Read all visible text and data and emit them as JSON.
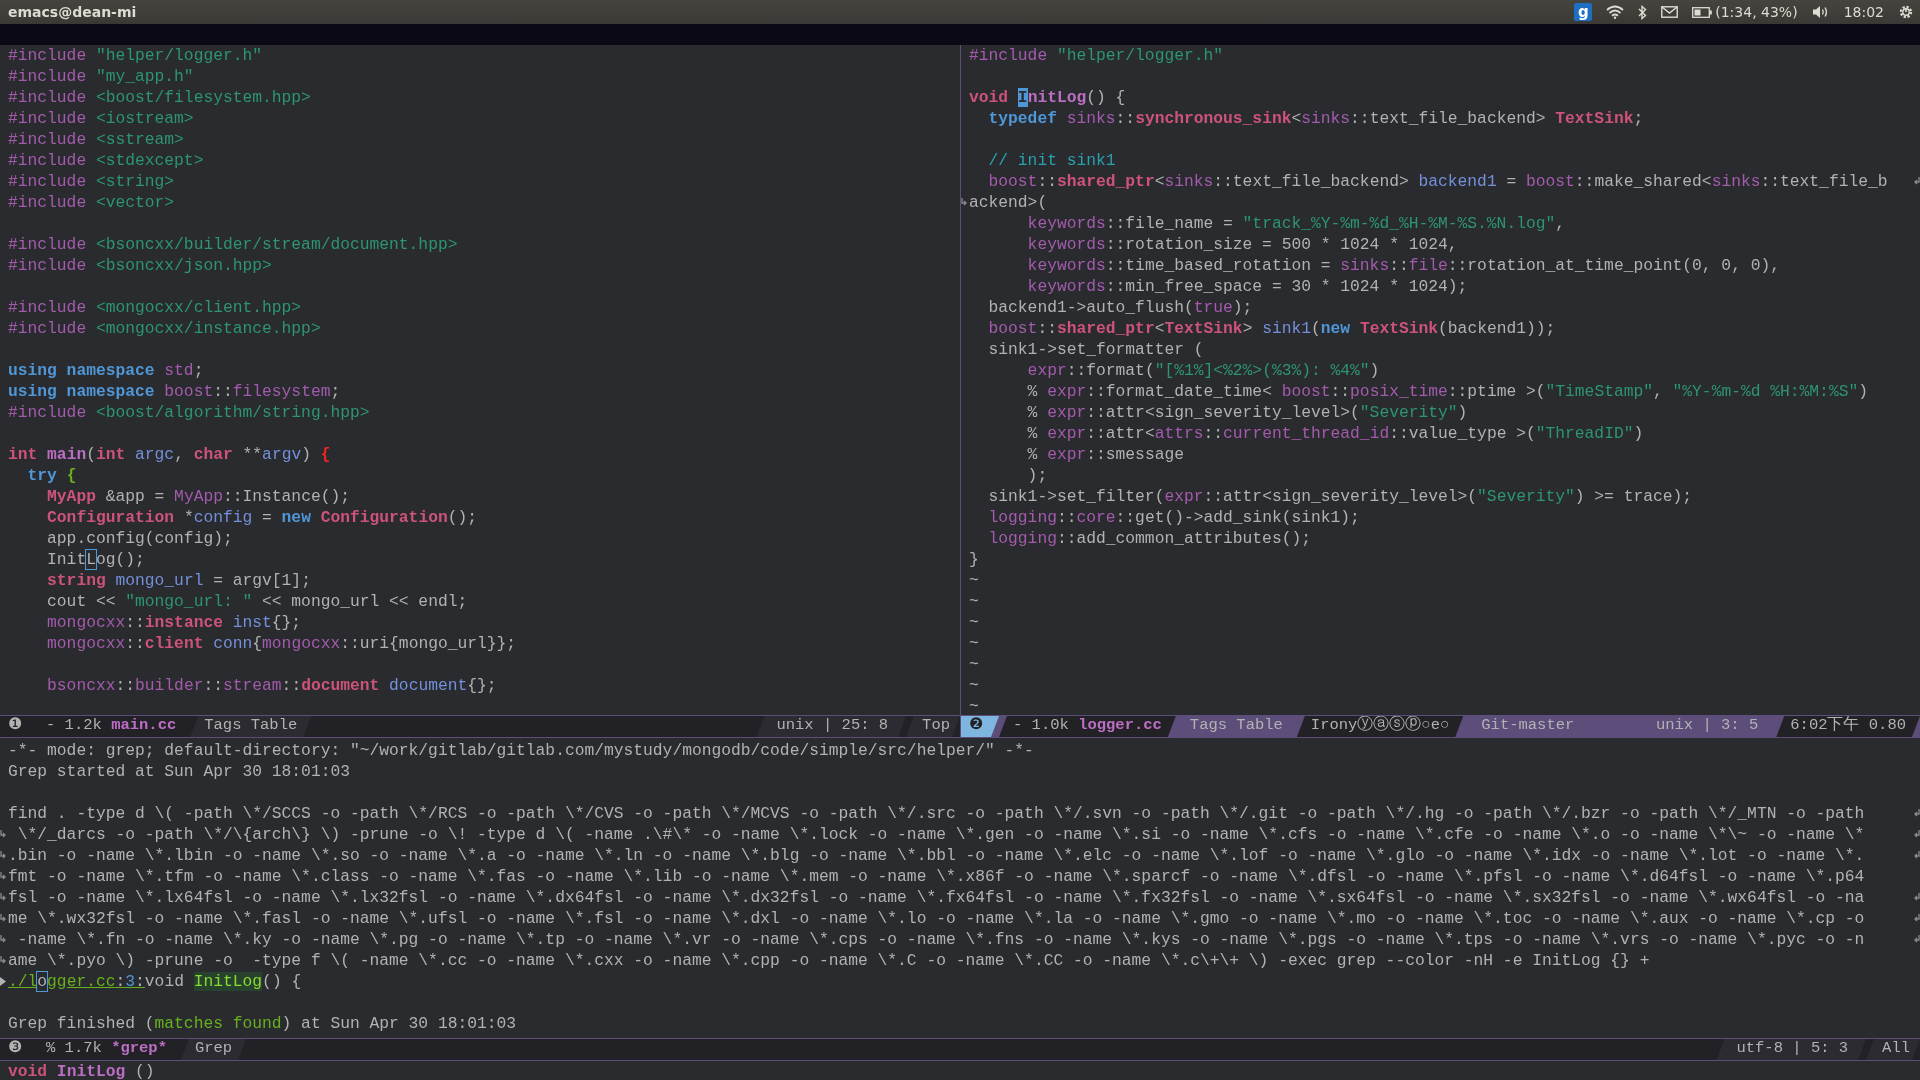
{
  "top_panel": {
    "title": "emacs@dean-mi",
    "indicator": "g",
    "battery": "(1:34, 43%)",
    "clock": "18:02"
  },
  "top_windows": [
    {
      "selected": false,
      "lines": [
        {
          "kind": "code",
          "tokens": [
            {
              "kind": "pp",
              "text": "#include "
            },
            {
              "kind": "str",
              "text": "\"helper/logger.h\""
            }
          ]
        },
        {
          "kind": "code",
          "tokens": [
            {
              "kind": "pp",
              "text": "#include "
            },
            {
              "kind": "str",
              "text": "\"my_app.h\""
            }
          ]
        },
        {
          "kind": "code",
          "tokens": [
            {
              "kind": "pp",
              "text": "#include "
            },
            {
              "kind": "str",
              "text": "<boost/filesystem.hpp>"
            }
          ]
        },
        {
          "kind": "code",
          "tokens": [
            {
              "kind": "pp",
              "text": "#include "
            },
            {
              "kind": "str",
              "text": "<iostream>"
            }
          ]
        },
        {
          "kind": "code",
          "tokens": [
            {
              "kind": "pp",
              "text": "#include "
            },
            {
              "kind": "str",
              "text": "<sstream>"
            }
          ]
        },
        {
          "kind": "code",
          "tokens": [
            {
              "kind": "pp",
              "text": "#include "
            },
            {
              "kind": "str",
              "text": "<stdexcept>"
            }
          ]
        },
        {
          "kind": "code",
          "tokens": [
            {
              "kind": "pp",
              "text": "#include "
            },
            {
              "kind": "str",
              "text": "<string>"
            }
          ]
        },
        {
          "kind": "code",
          "tokens": [
            {
              "kind": "pp",
              "text": "#include "
            },
            {
              "kind": "str",
              "text": "<vector>"
            }
          ]
        },
        {
          "kind": "blank"
        },
        {
          "kind": "code",
          "tokens": [
            {
              "kind": "pp",
              "text": "#include "
            },
            {
              "kind": "str",
              "text": "<bsoncxx/builder/stream/document.hpp>"
            }
          ]
        },
        {
          "kind": "code",
          "tokens": [
            {
              "kind": "pp",
              "text": "#include "
            },
            {
              "kind": "str",
              "text": "<bsoncxx/json.hpp>"
            }
          ]
        },
        {
          "kind": "blank"
        },
        {
          "kind": "code",
          "tokens": [
            {
              "kind": "pp",
              "text": "#include "
            },
            {
              "kind": "str",
              "text": "<mongocxx/client.hpp>"
            }
          ]
        },
        {
          "kind": "code",
          "tokens": [
            {
              "kind": "pp",
              "text": "#include "
            },
            {
              "kind": "str",
              "text": "<mongocxx/instance.hpp>"
            }
          ]
        },
        {
          "kind": "blank"
        },
        {
          "kind": "code",
          "tokens": [
            {
              "kind": "kw",
              "text": "using namespace "
            },
            {
              "kind": "ns",
              "text": "std"
            },
            {
              "kind": "plain",
              "text": ";"
            }
          ]
        },
        {
          "kind": "code",
          "tokens": [
            {
              "kind": "kw",
              "text": "using namespace "
            },
            {
              "kind": "ns",
              "text": "boost"
            },
            {
              "kind": "plain",
              "text": "::"
            },
            {
              "kind": "ns",
              "text": "filesystem"
            },
            {
              "kind": "plain",
              "text": ";"
            }
          ]
        },
        {
          "kind": "code",
          "tokens": [
            {
              "kind": "pp",
              "text": "#include "
            },
            {
              "kind": "str",
              "text": "<boost/algorithm/string.hpp>"
            }
          ]
        },
        {
          "kind": "blank"
        },
        {
          "kind": "code",
          "tokens": [
            {
              "kind": "type",
              "text": "int "
            },
            {
              "kind": "fn",
              "text": "main"
            },
            {
              "kind": "plain",
              "text": "("
            },
            {
              "kind": "type",
              "text": "int "
            },
            {
              "kind": "var",
              "text": "argc"
            },
            {
              "kind": "plain",
              "text": ", "
            },
            {
              "kind": "type",
              "text": "char"
            },
            {
              "kind": "plain",
              "text": " **"
            },
            {
              "kind": "var",
              "text": "argv"
            },
            {
              "kind": "plain",
              "text": ") "
            },
            {
              "kind": "delim-red",
              "text": "{"
            }
          ]
        },
        {
          "kind": "code",
          "tokens": [
            {
              "kind": "kw",
              "text": "  try "
            },
            {
              "kind": "delim-green",
              "text": "{"
            }
          ]
        },
        {
          "kind": "code",
          "tokens": [
            {
              "kind": "type",
              "text": "    MyApp"
            },
            {
              "kind": "plain",
              "text": " &app = "
            },
            {
              "kind": "ns",
              "text": "MyApp"
            },
            {
              "kind": "plain",
              "text": "::Instance();"
            }
          ]
        },
        {
          "kind": "code",
          "tokens": [
            {
              "kind": "type",
              "text": "    Configuration"
            },
            {
              "kind": "plain",
              "text": " *"
            },
            {
              "kind": "var",
              "text": "config"
            },
            {
              "kind": "plain",
              "text": " = "
            },
            {
              "kind": "kw",
              "text": "new "
            },
            {
              "kind": "type",
              "text": "Configuration"
            },
            {
              "kind": "plain",
              "text": "();"
            }
          ]
        },
        {
          "kind": "code",
          "tokens": [
            {
              "kind": "plain",
              "text": "    app.config(config);"
            }
          ]
        },
        {
          "kind": "code",
          "tokens": [
            {
              "kind": "plain",
              "text": "    Init"
            },
            {
              "kind": "cursor-box",
              "text": "L"
            },
            {
              "kind": "plain",
              "text": "og();"
            }
          ]
        },
        {
          "kind": "code",
          "tokens": [
            {
              "kind": "type",
              "text": "    string "
            },
            {
              "kind": "var",
              "text": "mongo_url"
            },
            {
              "kind": "plain",
              "text": " = argv[1];"
            }
          ]
        },
        {
          "kind": "code",
          "tokens": [
            {
              "kind": "plain",
              "text": "    cout << "
            },
            {
              "kind": "str",
              "text": "\"mongo_url: \""
            },
            {
              "kind": "plain",
              "text": " << mongo_url << endl;"
            }
          ]
        },
        {
          "kind": "code",
          "tokens": [
            {
              "kind": "ns",
              "text": "    mongocxx"
            },
            {
              "kind": "plain",
              "text": "::"
            },
            {
              "kind": "type",
              "text": "instance "
            },
            {
              "kind": "var",
              "text": "inst"
            },
            {
              "kind": "plain",
              "text": "{};"
            }
          ]
        },
        {
          "kind": "code",
          "tokens": [
            {
              "kind": "ns",
              "text": "    mongocxx"
            },
            {
              "kind": "plain",
              "text": "::"
            },
            {
              "kind": "type",
              "text": "client "
            },
            {
              "kind": "var",
              "text": "conn"
            },
            {
              "kind": "plain",
              "text": "{"
            },
            {
              "kind": "ns",
              "text": "mongocxx"
            },
            {
              "kind": "plain",
              "text": "::uri{mongo_url}};"
            }
          ]
        },
        {
          "kind": "blank"
        },
        {
          "kind": "code",
          "tokens": [
            {
              "kind": "ns",
              "text": "    bsoncxx"
            },
            {
              "kind": "plain",
              "text": "::"
            },
            {
              "kind": "ns",
              "text": "builder"
            },
            {
              "kind": "plain",
              "text": "::"
            },
            {
              "kind": "ns",
              "text": "stream"
            },
            {
              "kind": "plain",
              "text": "::"
            },
            {
              "kind": "type",
              "text": "document "
            },
            {
              "kind": "var",
              "text": "document"
            },
            {
              "kind": "plain",
              "text": "{};"
            }
          ]
        }
      ],
      "mode_line": {
        "number": "❶",
        "size": "- 1.2k",
        "buffer": "main.cc",
        "left": [
          {
            "kind": "mode",
            "text": "Tags Table"
          }
        ],
        "right": [
          {
            "kind": "position",
            "text": "unix | 25: 8"
          },
          {
            "kind": "percent",
            "text": "Top"
          }
        ]
      }
    },
    {
      "selected": true,
      "lines": [
        {
          "kind": "code",
          "tokens": [
            {
              "kind": "pp",
              "text": "#include "
            },
            {
              "kind": "str",
              "text": "\"helper/logger.h\""
            }
          ]
        },
        {
          "kind": "blank"
        },
        {
          "kind": "code",
          "tokens": [
            {
              "kind": "type",
              "text": "void "
            },
            {
              "kind": "cursor",
              "text": "I"
            },
            {
              "kind": "fn",
              "text": "nitLog"
            },
            {
              "kind": "plain",
              "text": "() {"
            }
          ]
        },
        {
          "kind": "code",
          "tokens": [
            {
              "kind": "kw",
              "text": "  typedef "
            },
            {
              "kind": "ns",
              "text": "sinks"
            },
            {
              "kind": "plain",
              "text": "::"
            },
            {
              "kind": "type",
              "text": "synchronous_sink"
            },
            {
              "kind": "plain",
              "text": "<"
            },
            {
              "kind": "ns",
              "text": "sinks"
            },
            {
              "kind": "plain",
              "text": "::text_file_backend> "
            },
            {
              "kind": "type",
              "text": "TextSink"
            },
            {
              "kind": "plain",
              "text": ";"
            }
          ]
        },
        {
          "kind": "blank"
        },
        {
          "kind": "code",
          "tokens": [
            {
              "kind": "cmt",
              "text": "  // init sink1"
            }
          ]
        },
        {
          "kind": "code",
          "continued": true,
          "tokens": [
            {
              "kind": "ns",
              "text": "  boost"
            },
            {
              "kind": "plain",
              "text": "::"
            },
            {
              "kind": "type",
              "text": "shared_ptr"
            },
            {
              "kind": "plain",
              "text": "<"
            },
            {
              "kind": "ns",
              "text": "sinks"
            },
            {
              "kind": "plain",
              "text": "::text_file_backend> "
            },
            {
              "kind": "var",
              "text": "backend1"
            },
            {
              "kind": "plain",
              "text": " = "
            },
            {
              "kind": "ns",
              "text": "boost"
            },
            {
              "kind": "plain",
              "text": "::make_shared<"
            },
            {
              "kind": "ns",
              "text": "sinks"
            },
            {
              "kind": "plain",
              "text": "::text_file_b"
            }
          ]
        },
        {
          "kind": "code",
          "continuation": true,
          "tokens": [
            {
              "kind": "plain",
              "text": "ackend>("
            }
          ]
        },
        {
          "kind": "code",
          "tokens": [
            {
              "kind": "ns",
              "text": "      keywords"
            },
            {
              "kind": "plain",
              "text": "::file_name = "
            },
            {
              "kind": "str",
              "text": "\"track_%Y-%m-%d_%H-%M-%S.%N.log\""
            },
            {
              "kind": "plain",
              "text": ","
            }
          ]
        },
        {
          "kind": "code",
          "tokens": [
            {
              "kind": "ns",
              "text": "      keywords"
            },
            {
              "kind": "plain",
              "text": "::rotation_size = 500 * 1024 * 1024,"
            }
          ]
        },
        {
          "kind": "code",
          "tokens": [
            {
              "kind": "ns",
              "text": "      keywords"
            },
            {
              "kind": "plain",
              "text": "::time_based_rotation = "
            },
            {
              "kind": "ns",
              "text": "sinks"
            },
            {
              "kind": "plain",
              "text": "::"
            },
            {
              "kind": "ns",
              "text": "file"
            },
            {
              "kind": "plain",
              "text": "::rotation_at_time_point(0, 0, 0),"
            }
          ]
        },
        {
          "kind": "code",
          "tokens": [
            {
              "kind": "ns",
              "text": "      keywords"
            },
            {
              "kind": "plain",
              "text": "::min_free_space = 30 * 1024 * 1024);"
            }
          ]
        },
        {
          "kind": "code",
          "tokens": [
            {
              "kind": "plain",
              "text": "  backend1->auto_flush("
            },
            {
              "kind": "const",
              "text": "true"
            },
            {
              "kind": "plain",
              "text": ");"
            }
          ]
        },
        {
          "kind": "code",
          "tokens": [
            {
              "kind": "ns",
              "text": "  boost"
            },
            {
              "kind": "plain",
              "text": "::"
            },
            {
              "kind": "type",
              "text": "shared_ptr"
            },
            {
              "kind": "plain",
              "text": "<"
            },
            {
              "kind": "type",
              "text": "TextSink"
            },
            {
              "kind": "plain",
              "text": "> "
            },
            {
              "kind": "var",
              "text": "sink1"
            },
            {
              "kind": "plain",
              "text": "("
            },
            {
              "kind": "kw",
              "text": "new "
            },
            {
              "kind": "type",
              "text": "TextSink"
            },
            {
              "kind": "plain",
              "text": "(backend1));"
            }
          ]
        },
        {
          "kind": "code",
          "tokens": [
            {
              "kind": "plain",
              "text": "  sink1->set_formatter ("
            }
          ]
        },
        {
          "kind": "code",
          "tokens": [
            {
              "kind": "ns",
              "text": "      expr"
            },
            {
              "kind": "plain",
              "text": "::format("
            },
            {
              "kind": "str",
              "text": "\"[%1%]<%2%>(%3%): %4%\""
            },
            {
              "kind": "plain",
              "text": ")"
            }
          ]
        },
        {
          "kind": "code",
          "tokens": [
            {
              "kind": "plain",
              "text": "      % "
            },
            {
              "kind": "ns",
              "text": "expr"
            },
            {
              "kind": "plain",
              "text": "::format_date_time< "
            },
            {
              "kind": "ns",
              "text": "boost"
            },
            {
              "kind": "plain",
              "text": "::"
            },
            {
              "kind": "ns",
              "text": "posix_time"
            },
            {
              "kind": "plain",
              "text": "::ptime >("
            },
            {
              "kind": "str",
              "text": "\"TimeStamp\""
            },
            {
              "kind": "plain",
              "text": ", "
            },
            {
              "kind": "str",
              "text": "\"%Y-%m-%d %H:%M:%S\""
            },
            {
              "kind": "plain",
              "text": ")"
            }
          ]
        },
        {
          "kind": "code",
          "tokens": [
            {
              "kind": "plain",
              "text": "      % "
            },
            {
              "kind": "ns",
              "text": "expr"
            },
            {
              "kind": "plain",
              "text": "::attr<sign_severity_level>("
            },
            {
              "kind": "str",
              "text": "\"Severity\""
            },
            {
              "kind": "plain",
              "text": ")"
            }
          ]
        },
        {
          "kind": "code",
          "tokens": [
            {
              "kind": "plain",
              "text": "      % "
            },
            {
              "kind": "ns",
              "text": "expr"
            },
            {
              "kind": "plain",
              "text": "::attr<"
            },
            {
              "kind": "ns",
              "text": "attrs"
            },
            {
              "kind": "plain",
              "text": "::"
            },
            {
              "kind": "ns",
              "text": "current_thread_id"
            },
            {
              "kind": "plain",
              "text": "::value_type >("
            },
            {
              "kind": "str",
              "text": "\"ThreadID\""
            },
            {
              "kind": "plain",
              "text": ")"
            }
          ]
        },
        {
          "kind": "code",
          "tokens": [
            {
              "kind": "plain",
              "text": "      % "
            },
            {
              "kind": "ns",
              "text": "expr"
            },
            {
              "kind": "plain",
              "text": "::smessage"
            }
          ]
        },
        {
          "kind": "code",
          "tokens": [
            {
              "kind": "plain",
              "text": "      );"
            }
          ]
        },
        {
          "kind": "code",
          "tokens": [
            {
              "kind": "plain",
              "text": "  sink1->set_filter("
            },
            {
              "kind": "ns",
              "text": "expr"
            },
            {
              "kind": "plain",
              "text": "::attr<sign_severity_level>("
            },
            {
              "kind": "str",
              "text": "\"Severity\""
            },
            {
              "kind": "plain",
              "text": ") >= trace);"
            }
          ]
        },
        {
          "kind": "code",
          "tokens": [
            {
              "kind": "ns",
              "text": "  logging"
            },
            {
              "kind": "plain",
              "text": "::"
            },
            {
              "kind": "ns",
              "text": "core"
            },
            {
              "kind": "plain",
              "text": "::get()->add_sink(sink1);"
            }
          ]
        },
        {
          "kind": "code",
          "tokens": [
            {
              "kind": "ns",
              "text": "  logging"
            },
            {
              "kind": "plain",
              "text": "::add_common_attributes();"
            }
          ]
        },
        {
          "kind": "code",
          "tokens": [
            {
              "kind": "plain",
              "text": "}"
            }
          ]
        },
        {
          "kind": "code",
          "tokens": [
            {
              "kind": "plain",
              "text": "~"
            }
          ]
        },
        {
          "kind": "code",
          "tokens": [
            {
              "kind": "plain",
              "text": "~"
            }
          ]
        },
        {
          "kind": "code",
          "tokens": [
            {
              "kind": "plain",
              "text": "~"
            }
          ]
        },
        {
          "kind": "code",
          "tokens": [
            {
              "kind": "plain",
              "text": "~"
            }
          ]
        },
        {
          "kind": "code",
          "tokens": [
            {
              "kind": "plain",
              "text": "~"
            }
          ]
        },
        {
          "kind": "code",
          "tokens": [
            {
              "kind": "plain",
              "text": "~"
            }
          ]
        },
        {
          "kind": "code",
          "tokens": [
            {
              "kind": "plain",
              "text": "~"
            }
          ]
        }
      ],
      "mode_line": {
        "number": "❷",
        "size": "- 1.0k",
        "buffer": "logger.cc",
        "left": [
          {
            "kind": "mode",
            "text": "Tags Table"
          },
          {
            "kind": "minor",
            "text": "Ironyⓨⓐⓢⓟ○e○"
          },
          {
            "kind": "vc",
            "text": "Git-master"
          }
        ],
        "right": [
          {
            "kind": "position",
            "text": "unix | 3: 5"
          },
          {
            "kind": "time",
            "text": "6:02下午 0.80"
          }
        ]
      }
    }
  ],
  "grep_window": {
    "selected": false,
    "lines": [
      {
        "kind": "code",
        "tokens": [
          {
            "kind": "plain",
            "text": "-*- mode: grep; default-directory: \"~/work/gitlab/gitlab.com/mystudy/mongodb/code/simple/src/helper/\" -*-"
          }
        ]
      },
      {
        "kind": "code",
        "tokens": [
          {
            "kind": "plain",
            "text": "Grep started at Sun Apr 30 18:01:03"
          }
        ]
      },
      {
        "kind": "blank"
      },
      {
        "kind": "code",
        "continued": true,
        "tokens": [
          {
            "kind": "plain",
            "text": "find . -type d \\( -path \\*/SCCS -o -path \\*/RCS -o -path \\*/CVS -o -path \\*/MCVS -o -path \\*/.src -o -path \\*/.svn -o -path \\*/.git -o -path \\*/.hg -o -path \\*/.bzr -o -path \\*/_MTN -o -path"
          }
        ]
      },
      {
        "kind": "code",
        "continuation": true,
        "continued": true,
        "tokens": [
          {
            "kind": "plain",
            "text": " \\*/_darcs -o -path \\*/\\{arch\\} \\) -prune -o \\! -type d \\( -name .\\#\\* -o -name \\*.lock -o -name \\*.gen -o -name \\*.si -o -name \\*.cfs -o -name \\*.cfe -o -name \\*.o -o -name \\*\\~ -o -name \\*"
          }
        ]
      },
      {
        "kind": "code",
        "continuation": true,
        "continued": true,
        "tokens": [
          {
            "kind": "plain",
            "text": ".bin -o -name \\*.lbin -o -name \\*.so -o -name \\*.a -o -name \\*.ln -o -name \\*.blg -o -name \\*.bbl -o -name \\*.elc -o -name \\*.lof -o -name \\*.glo -o -name \\*.idx -o -name \\*.lot -o -name \\*."
          }
        ]
      },
      {
        "kind": "code",
        "continuation": true,
        "tokens": [
          {
            "kind": "plain",
            "text": "fmt -o -name \\*.tfm -o -name \\*.class -o -name \\*.fas -o -name \\*.lib -o -name \\*.mem -o -name \\*.x86f -o -name \\*.sparcf -o -name \\*.dfsl -o -name \\*.pfsl -o -name \\*.d64fsl -o -name \\*.p64"
          }
        ]
      },
      {
        "kind": "code",
        "continuation": true,
        "continued": true,
        "tokens": [
          {
            "kind": "plain",
            "text": "fsl -o -name \\*.lx64fsl -o -name \\*.lx32fsl -o -name \\*.dx64fsl -o -name \\*.dx32fsl -o -name \\*.fx64fsl -o -name \\*.fx32fsl -o -name \\*.sx64fsl -o -name \\*.sx32fsl -o -name \\*.wx64fsl -o -na"
          }
        ]
      },
      {
        "kind": "code",
        "continuation": true,
        "continued": true,
        "tokens": [
          {
            "kind": "plain",
            "text": "me \\*.wx32fsl -o -name \\*.fasl -o -name \\*.ufsl -o -name \\*.fsl -o -name \\*.dxl -o -name \\*.lo -o -name \\*.la -o -name \\*.gmo -o -name \\*.mo -o -name \\*.toc -o -name \\*.aux -o -name \\*.cp -o"
          }
        ]
      },
      {
        "kind": "code",
        "continuation": true,
        "continued": true,
        "tokens": [
          {
            "kind": "plain",
            "text": " -name \\*.fn -o -name \\*.ky -o -name \\*.pg -o -name \\*.tp -o -name \\*.vr -o -name \\*.cps -o -name \\*.fns -o -name \\*.kys -o -name \\*.pgs -o -name \\*.tps -o -name \\*.vrs -o -name \\*.pyc -o -n"
          }
        ]
      },
      {
        "kind": "code",
        "continuation": true,
        "tokens": [
          {
            "kind": "plain",
            "text": "ame \\*.pyo \\) -prune -o  -type f \\( -name \\*.cc -o -name \\*.cxx -o -name \\*.cpp -o -name \\*.C -o -name \\*.CC -o -name \\*.c\\+\\+ \\) -exec grep --color -nH -e InitLog {} +"
          }
        ]
      },
      {
        "kind": "code",
        "current": true,
        "tokens": [
          {
            "kind": "link",
            "text": "./l"
          },
          {
            "kind": "cursor-box",
            "text": "o"
          },
          {
            "kind": "link",
            "text": "gger.cc"
          },
          {
            "kind": "link-plain",
            "text": ":"
          },
          {
            "kind": "linenum",
            "text": "3"
          },
          {
            "kind": "link-plain",
            "text": ":"
          },
          {
            "kind": "plain",
            "text": "void "
          },
          {
            "kind": "match",
            "text": "InitLog"
          },
          {
            "kind": "plain",
            "text": "() {"
          }
        ]
      },
      {
        "kind": "blank"
      },
      {
        "kind": "code",
        "tokens": [
          {
            "kind": "plain",
            "text": "Grep finished ("
          },
          {
            "kind": "ok",
            "text": "matches found"
          },
          {
            "kind": "plain",
            "text": ") at Sun Apr 30 18:01:03"
          }
        ]
      }
    ],
    "mode_line": {
      "number": "❸",
      "size": "% 1.7k",
      "buffer": "*grep*",
      "left": [
        {
          "kind": "mode",
          "text": "Grep"
        }
      ],
      "right": [
        {
          "kind": "position",
          "text": "utf-8 | 5: 3"
        },
        {
          "kind": "percent",
          "text": "All"
        }
      ]
    }
  },
  "echo_area": {
    "tokens": [
      {
        "kind": "type",
        "text": "void "
      },
      {
        "kind": "fn",
        "text": "InitLog"
      },
      {
        "kind": "plain",
        "text": " ()"
      }
    ]
  }
}
